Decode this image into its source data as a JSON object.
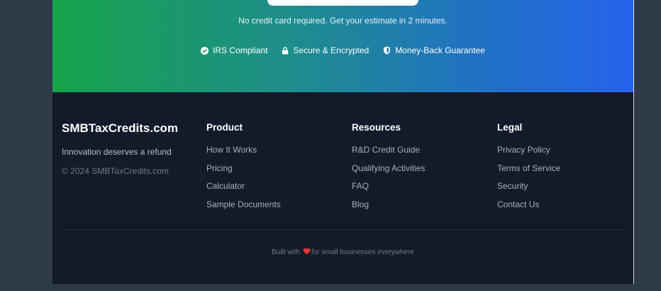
{
  "cta": {
    "note": "No credit card required. Get your estimate in 2 minutes.",
    "badges": [
      {
        "icon": "check-circle-icon",
        "label": "IRS Compliant"
      },
      {
        "icon": "lock-icon",
        "label": "Secure & Encrypted"
      },
      {
        "icon": "shield-icon",
        "label": "Money-Back Guarantee"
      }
    ]
  },
  "footer": {
    "brand": {
      "name": "SMBTaxCredits.com",
      "tagline": "Innovation deserves a refund",
      "copyright": "© 2024 SMBTaxCredits.com"
    },
    "columns": [
      {
        "title": "Product",
        "links": [
          "How It Works",
          "Pricing",
          "Calculator",
          "Sample Documents"
        ]
      },
      {
        "title": "Resources",
        "links": [
          "R&D Credit Guide",
          "Qualifying Activities",
          "FAQ",
          "Blog"
        ]
      },
      {
        "title": "Legal",
        "links": [
          "Privacy Policy",
          "Terms of Service",
          "Security",
          "Contact Us"
        ]
      }
    ],
    "built_prefix": "Built with",
    "built_suffix": "for small businesses everywhere"
  },
  "colors": {
    "gradient_start": "#17a34a",
    "gradient_end": "#2563eb",
    "footer_bg": "#131a2a",
    "page_bg": "#2f3a49",
    "heart": "#e53935"
  }
}
